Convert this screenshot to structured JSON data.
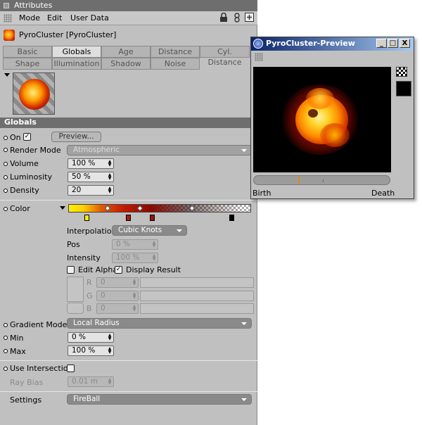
{
  "manager": {
    "title": "Attributes",
    "menu": [
      "Mode",
      "Edit",
      "User Data"
    ],
    "icons": [
      "lock-icon",
      "link-icon",
      "new-window-icon"
    ],
    "object_name": "PyroCluster [PyroCluster]",
    "tabs_row1": [
      "Basic",
      "Globals",
      "Age",
      "Distance",
      "Cyl. Distance"
    ],
    "tabs_row2": [
      "Shape",
      "Illumination",
      "Shadow",
      "Noise"
    ],
    "active_tab": "Globals",
    "section_title": "Globals"
  },
  "globals": {
    "on_label": "On",
    "on_checked": true,
    "preview_button": "Preview...",
    "render_mode_label": "Render Mode",
    "render_mode_value": "Atmospheric",
    "volume_label": "Volume",
    "volume_value": "100 %",
    "luminosity_label": "Luminosity",
    "luminosity_value": "50 %",
    "density_label": "Density",
    "density_value": "20"
  },
  "color": {
    "label": "Color",
    "interpolation_label": "Interpolation",
    "interpolation_value": "Cubic Knots",
    "pos_label": "Pos",
    "pos_value": "0 %",
    "intensity_label": "Intensity",
    "intensity_value": "100 %",
    "edit_alpha_label": "Edit Alpha",
    "edit_alpha_checked": false,
    "display_result_label": "Display Result",
    "display_result_checked": true,
    "r_label": "R",
    "r_value": "0",
    "g_label": "G",
    "g_value": "0",
    "b_label": "B",
    "b_value": "0",
    "knot_colors": [
      "#ffee00",
      "#b01a10",
      "#a01008",
      "#000000"
    ]
  },
  "gradient_mode": {
    "label": "Gradient Mode",
    "value": "Local Radius",
    "min_label": "Min",
    "min_value": "0 %",
    "max_label": "Max",
    "max_value": "100 %"
  },
  "intersection": {
    "use_label": "Use Intersection",
    "use_checked": false,
    "ray_bias_label": "Ray Bias",
    "ray_bias_value": "0.01 m"
  },
  "settings": {
    "label": "Settings",
    "value": "FireBall"
  },
  "preview": {
    "title": "PyroCluster-Preview",
    "buttons": [
      "_",
      "□",
      "X"
    ],
    "birth_label": "Birth",
    "death_label": "Death",
    "timeline_position": 0.33,
    "accent": "#e08a00"
  }
}
